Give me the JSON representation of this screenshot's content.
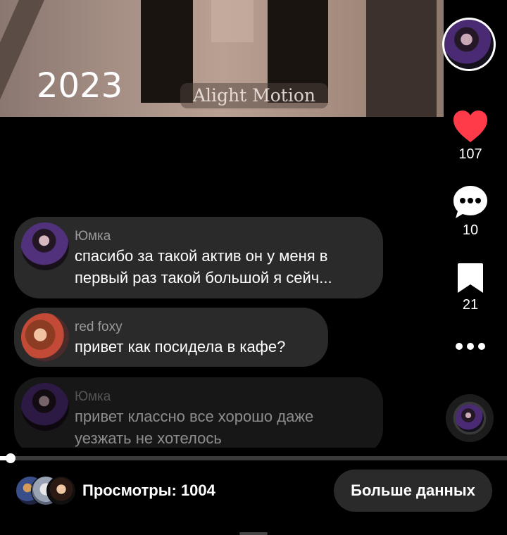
{
  "video": {
    "year_overlay": "2023",
    "watermark": "Alight Motion"
  },
  "actions": {
    "likes": "107",
    "comments": "10",
    "bookmarks": "21"
  },
  "comments": [
    {
      "user": "Юмка",
      "text": "спасибо за такой актив он у меня в первый раз такой большой я сейч..."
    },
    {
      "user": "red foxy",
      "text": "привет как посидела в кафе?"
    },
    {
      "user": "Юмка",
      "text": "привет классно все хорошо даже уезжать не хотелось"
    }
  ],
  "playback": {
    "progress": 0.02
  },
  "footer": {
    "views": "Просмотры: 1004",
    "more_data_button": "Больше данных"
  },
  "colors": {
    "like": "#ff3b4a",
    "bubble": "#2a2a2a",
    "background": "#000000"
  },
  "icons": [
    "heart-icon",
    "comment-icon",
    "bookmark-icon",
    "more-icon"
  ]
}
